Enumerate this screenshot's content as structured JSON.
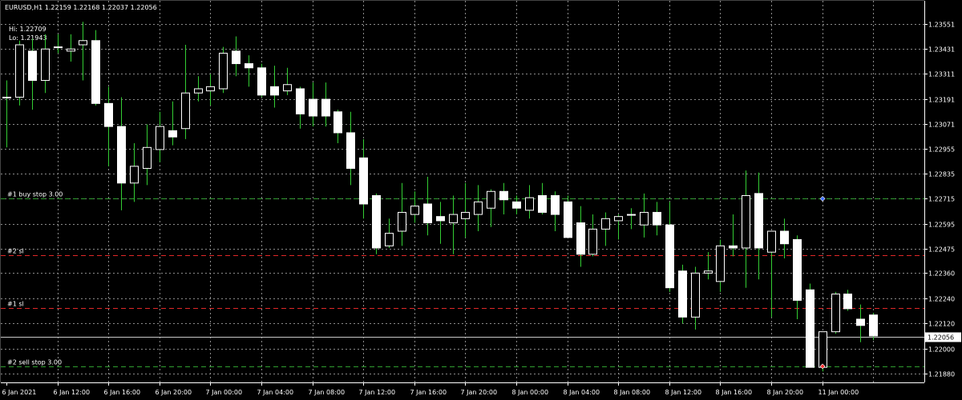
{
  "header": {
    "symbol_line": "EURUSD,H1  1.22159 1.22168 1.22037 1.22056",
    "hi_line": "Hi: 1.22709",
    "lo_line": "Lo: 1.21943"
  },
  "colors": {
    "background": "#000000",
    "grid": "#8a8a8a",
    "axis": "#ffffff",
    "candle_bull_body": "#000000",
    "candle_bear_body": "#ffffff",
    "candle_outline": "#ffffff",
    "wick": "#33cc33",
    "pending_line": "#2f9e2f",
    "sl_line": "#e02828",
    "current_price_line": "#c8c8c8",
    "price_tag_bg": "#ffffff",
    "price_tag_text": "#000000"
  },
  "chart_data": {
    "type": "candlestick",
    "symbol": "EURUSD",
    "timeframe": "H1",
    "ylim": [
      1.2184,
      1.2362
    ],
    "y_ticks": [
      "1.23551",
      "1.23431",
      "1.23311",
      "1.23191",
      "1.23071",
      "1.22955",
      "1.22835",
      "1.22715",
      "1.22595",
      "1.22475",
      "1.22360",
      "1.22240",
      "1.22120",
      "1.22000",
      "1.21880"
    ],
    "y_tick_values": [
      1.23551,
      1.23431,
      1.23311,
      1.23191,
      1.23071,
      1.22955,
      1.22835,
      1.22715,
      1.22595,
      1.22475,
      1.2236,
      1.2224,
      1.2212,
      1.22,
      1.2188
    ],
    "x_ticks": [
      "6 Jan 2021",
      "6 Jan 12:00",
      "6 Jan 16:00",
      "6 Jan 20:00",
      "7 Jan 00:00",
      "7 Jan 04:00",
      "7 Jan 08:00",
      "7 Jan 12:00",
      "7 Jan 16:00",
      "7 Jan 20:00",
      "8 Jan 00:00",
      "8 Jan 04:00",
      "8 Jan 08:00",
      "8 Jan 12:00",
      "8 Jan 16:00",
      "8 Jan 20:00",
      "11 Jan 00:00"
    ],
    "current_price": "1.22056",
    "current_price_value": 1.22056,
    "levels": [
      {
        "label": "#1 buy stop 3.00",
        "price": 1.22715,
        "kind": "pending"
      },
      {
        "label": "#2 sl",
        "price": 1.22445,
        "kind": "sl"
      },
      {
        "label": "#1 sl",
        "price": 1.22195,
        "kind": "sl"
      },
      {
        "label": "#2 sell stop 3.00",
        "price": 1.21915,
        "kind": "pending"
      }
    ],
    "ohlc": [
      [
        1.232,
        1.2328,
        1.2296,
        1.232
      ],
      [
        1.232,
        1.2347,
        1.2316,
        1.2345
      ],
      [
        1.2342,
        1.2348,
        1.2314,
        1.2328
      ],
      [
        1.2328,
        1.235,
        1.2322,
        1.2343
      ],
      [
        1.2344,
        1.235,
        1.2341,
        1.2344
      ],
      [
        1.2342,
        1.235,
        1.2337,
        1.2343
      ],
      [
        1.2345,
        1.2356,
        1.2328,
        1.2347
      ],
      [
        1.2347,
        1.2352,
        1.2316,
        1.2317
      ],
      [
        1.2317,
        1.2325,
        1.2287,
        1.2306
      ],
      [
        1.2306,
        1.232,
        1.2266,
        1.2279
      ],
      [
        1.2279,
        1.2298,
        1.227,
        1.2287
      ],
      [
        1.2286,
        1.2307,
        1.2278,
        1.2296
      ],
      [
        1.2295,
        1.2313,
        1.2289,
        1.2306
      ],
      [
        1.2304,
        1.2318,
        1.2297,
        1.2301
      ],
      [
        1.2305,
        1.2345,
        1.23,
        1.2322
      ],
      [
        1.2322,
        1.233,
        1.2318,
        1.2324
      ],
      [
        1.2323,
        1.2331,
        1.2316,
        1.2325
      ],
      [
        1.2324,
        1.2344,
        1.2322,
        1.2341
      ],
      [
        1.2342,
        1.2349,
        1.233,
        1.2336
      ],
      [
        1.2336,
        1.234,
        1.2325,
        1.2334
      ],
      [
        1.2334,
        1.2336,
        1.232,
        1.2321
      ],
      [
        1.2325,
        1.2335,
        1.2315,
        1.2321
      ],
      [
        1.2323,
        1.2334,
        1.2321,
        1.2326
      ],
      [
        1.2324,
        1.2325,
        1.2305,
        1.2312
      ],
      [
        1.2319,
        1.2327,
        1.2306,
        1.2311
      ],
      [
        1.2319,
        1.2327,
        1.2306,
        1.2311
      ],
      [
        1.2313,
        1.2314,
        1.2298,
        1.2303
      ],
      [
        1.2303,
        1.2313,
        1.2278,
        1.2286
      ],
      [
        1.2291,
        1.23,
        1.2262,
        1.2269
      ],
      [
        1.2273,
        1.2274,
        1.2245,
        1.2248
      ],
      [
        1.2249,
        1.2262,
        1.2248,
        1.2255
      ],
      [
        1.2256,
        1.2279,
        1.2249,
        1.2265
      ],
      [
        1.2264,
        1.2275,
        1.226,
        1.2268
      ],
      [
        1.2269,
        1.2282,
        1.2254,
        1.226
      ],
      [
        1.2263,
        1.227,
        1.225,
        1.2261
      ],
      [
        1.226,
        1.2273,
        1.2245,
        1.2264
      ],
      [
        1.2262,
        1.2279,
        1.2253,
        1.2265
      ],
      [
        1.2264,
        1.2278,
        1.2256,
        1.227
      ],
      [
        1.2267,
        1.2276,
        1.2258,
        1.2275
      ],
      [
        1.2275,
        1.2279,
        1.2264,
        1.2271
      ],
      [
        1.227,
        1.2273,
        1.2264,
        1.2267
      ],
      [
        1.2266,
        1.2278,
        1.2262,
        1.2272
      ],
      [
        1.2273,
        1.2279,
        1.2264,
        1.2265
      ],
      [
        1.2273,
        1.2275,
        1.2256,
        1.2264
      ],
      [
        1.227,
        1.2273,
        1.2255,
        1.2253
      ],
      [
        1.226,
        1.2268,
        1.2239,
        1.2245
      ],
      [
        1.2245,
        1.2264,
        1.2244,
        1.2257
      ],
      [
        1.2257,
        1.2265,
        1.2249,
        1.2262
      ],
      [
        1.2261,
        1.2264,
        1.2252,
        1.2263
      ],
      [
        1.2264,
        1.2267,
        1.2257,
        1.2264
      ],
      [
        1.2259,
        1.2274,
        1.2253,
        1.2265
      ],
      [
        1.2265,
        1.227,
        1.2254,
        1.2259
      ],
      [
        1.2259,
        1.227,
        1.2227,
        1.2229
      ],
      [
        1.2237,
        1.224,
        1.2212,
        1.2215
      ],
      [
        1.2215,
        1.2239,
        1.2209,
        1.2236
      ],
      [
        1.2236,
        1.2246,
        1.2233,
        1.2237
      ],
      [
        1.2232,
        1.2252,
        1.2227,
        1.2249
      ],
      [
        1.2249,
        1.2264,
        1.2244,
        1.2248
      ],
      [
        1.2248,
        1.2285,
        1.2229,
        1.2273
      ],
      [
        1.2274,
        1.2284,
        1.2233,
        1.2248
      ],
      [
        1.2246,
        1.2256,
        1.2215,
        1.2256
      ],
      [
        1.2256,
        1.2262,
        1.2243,
        1.225
      ],
      [
        1.2252,
        1.2254,
        1.2214,
        1.2223
      ],
      [
        1.2228,
        1.2231,
        1.2191,
        1.2191
      ],
      [
        1.2191,
        1.2207,
        1.2189,
        1.2208
      ],
      [
        1.2208,
        1.2227,
        1.2207,
        1.2226
      ],
      [
        1.2226,
        1.2228,
        1.2218,
        1.2219
      ],
      [
        1.2214,
        1.2221,
        1.2203,
        1.2211
      ],
      [
        1.2216,
        1.2217,
        1.2204,
        1.2206
      ]
    ]
  }
}
